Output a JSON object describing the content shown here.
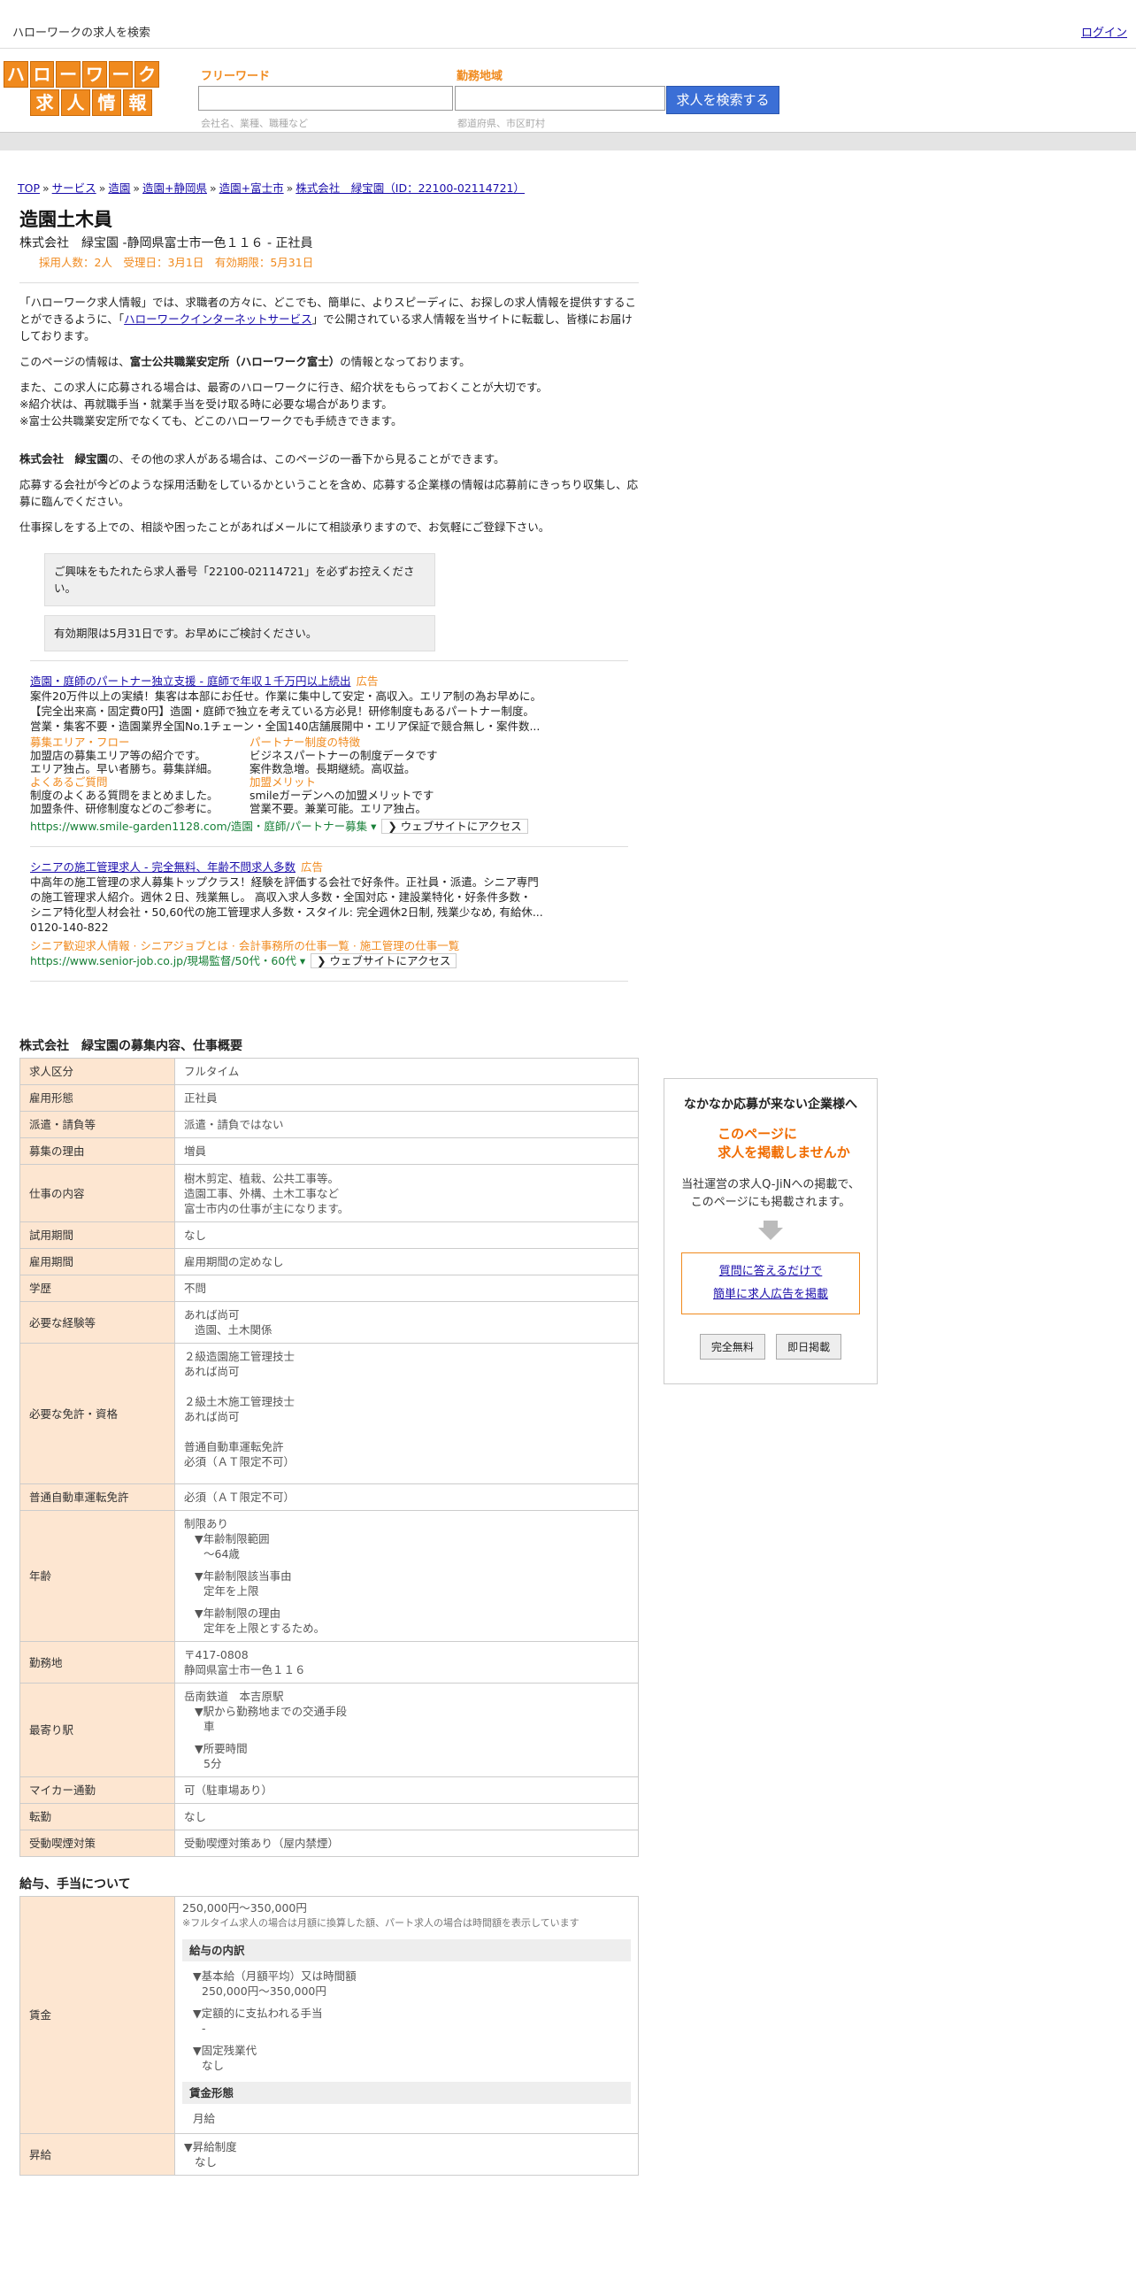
{
  "topbar": {
    "title": "ハローワークの求人を検索",
    "login": "ログイン"
  },
  "logo": {
    "row1": [
      "ハ",
      "ロ",
      "ー",
      "ワ",
      "ー",
      "ク"
    ],
    "row2": [
      "求",
      "人",
      "情",
      "報"
    ]
  },
  "search": {
    "keyword_label": "フリーワード",
    "keyword_placeholder": "会社名、業種、職種など",
    "area_label": "勤務地域",
    "area_placeholder": "都道府県、市区町村",
    "button": "求人を検索する"
  },
  "breadcrumb": [
    "TOP",
    "サービス",
    "造園",
    "造園+静岡県",
    "造園+富士市",
    "株式会社　緑宝園（ID：22100-02114721）"
  ],
  "job": {
    "title": "造園土木員",
    "subtitle": "株式会社　緑宝園 -静岡県富士市一色１１６ - 正社員",
    "meta": "採用人数：2人　受理日：3月1日　有効期限：5月31日"
  },
  "intro": {
    "p1_a": "「ハローワーク求人情報」では、求職者の方々に、どこでも、簡単に、よりスピーディに、お探しの求人情報を提供すすることができるように、「",
    "p1_link": "ハローワークインターネットサービス",
    "p1_b": "」で公開されている求人情報を当サイトに転載し、皆様にお届けしております。",
    "p2_a": "このページの情報は、",
    "p2_b": "富士公共職業安定所（ハローワーク富士）",
    "p2_c": "の情報となっております。",
    "p3_1": "また、この求人に応募される場合は、最寄のハローワークに行き、紹介状をもらっておくことが大切です。",
    "p3_2": "※紹介状は、再就職手当・就業手当を受け取る時に必要な場合があります。",
    "p3_3": "※富士公共職業安定所でなくても、どこのハローワークでも手続きできます。",
    "p4_a": "株式会社　緑宝園",
    "p4_b": "の、その他の求人がある場合は、このページの一番下から見ることができます。",
    "p5": "応募する会社が今どのような採用活動をしているかということを含め、応募する企業様の情報は応募前にきっちり収集し、応募に臨んでください。",
    "p6": "仕事探しをする上での、相談や困ったことがあればメールにて相談承りますので、お気軽にご登録下さい。",
    "notice1": "ご興味をもたれたら求人番号「22100-02114721」を必ずお控えください。",
    "notice2": "有効期限は5月31日です。お早めにご検討ください。"
  },
  "ads": [
    {
      "title": "造園・庭師のパートナー独立支援 - 庭師で年収１千万円以上続出",
      "tag": "広告",
      "l1": "案件20万件以上の実績！集客は本部にお任せ。作業に集中して安定・高収入。エリア制の為お早めに。",
      "l2": "【完全出来高・固定費0円】造園・庭師で独立を考えている方必見！研修制度もあるパートナー制度。",
      "l3": "営業・集客不要・造園業界全国No.1チェーン・全国140店舗展開中・エリア保証で競合無し・案件数...",
      "g1h": "募集エリア・フロー",
      "g1a": "加盟店の募集エリア等の紹介です。",
      "g1b": "エリア独占。早い者勝ち。募集詳細。",
      "g2h": "パートナー制度の特徴",
      "g2a": "ビジネスパートナーの制度データです",
      "g2b": "案件数急増。長期継続。高収益。",
      "g3h": "よくあるご質問",
      "g3a": "制度のよくある質問をまとめました。",
      "g3b": "加盟条件、研修制度などのご参考に。",
      "g4h": "加盟メリット",
      "g4a": "smileガーデンへの加盟メリットです",
      "g4b": "営業不要。兼業可能。エリア独占。",
      "url": "https://www.smile-garden1128.com/造園・庭師/パートナー募集 ▾",
      "visit": "❯ ウェブサイトにアクセス"
    },
    {
      "title": "シニアの施工管理求人 - 完全無料、年齢不問求人多数",
      "tag": "広告",
      "l1": "中高年の施工管理の求人募集トップクラス！経験を評価する会社で好条件。正社員・派遣。シニア専門",
      "l2": "の施工管理求人紹介。週休２日、残業無し。 高収入求人多数・全国対応・建設業特化・好条件多数・",
      "l3": "シニア特化型人材会社・50,60代の施工管理求人多数・スタイル: 完全週休2日制, 残業少なめ, 有給休...",
      "tel": "0120-140-822",
      "links": "シニア歓迎求人情報 · シニアジョブとは · 会計事務所の仕事一覧 · 施工管理の仕事一覧",
      "url": "https://www.senior-job.co.jp/現場監督/50代・60代 ▾",
      "visit": "❯ ウェブサイトにアクセス"
    }
  ],
  "overview": {
    "heading": "株式会社　緑宝園の募集内容、仕事概要",
    "rows": {
      "r1": [
        "求人区分",
        "フルタイム"
      ],
      "r2": [
        "雇用形態",
        "正社員"
      ],
      "r3": [
        "派遣・請負等",
        "派遣・請負ではない"
      ],
      "r4": [
        "募集の理由",
        "増員"
      ],
      "r5": [
        "仕事の内容",
        "樹木剪定、植栽、公共工事等。",
        "造園工事、外構、土木工事など",
        "富士市内の仕事が主になります。"
      ],
      "r6": [
        "試用期間",
        "なし"
      ],
      "r7": [
        "雇用期間",
        "雇用期間の定めなし"
      ],
      "r8": [
        "学歴",
        "不問"
      ],
      "r9": [
        "必要な経験等",
        "あれば尚可",
        "造園、土木関係"
      ],
      "r10": [
        "必要な免許・資格",
        "２級造園施工管理技士",
        "あれば尚可",
        "２級土木施工管理技士",
        "あれば尚可",
        "普通自動車運転免許",
        "必須（ＡＴ限定不可）"
      ],
      "r11": [
        "普通自動車運転免許",
        "必須（ＡＴ限定不可）"
      ],
      "r12": [
        "年齢",
        "制限あり",
        "▼年齢制限範囲",
        "〜64歳",
        "▼年齢制限該当事由",
        "定年を上限",
        "▼年齢制限の理由",
        "定年を上限とするため。"
      ],
      "r13": [
        "勤務地",
        "〒417-0808",
        "静岡県富士市一色１１６"
      ],
      "r14": [
        "最寄り駅",
        "岳南鉄道　本吉原駅",
        "▼駅から勤務地までの交通手段",
        "車",
        "▼所要時間",
        "5分"
      ],
      "r15": [
        "マイカー通勤",
        "可（駐車場あり）"
      ],
      "r16": [
        "転勤",
        "なし"
      ],
      "r17": [
        "受動喫煙対策",
        "受動喫煙対策あり（屋内禁煙）"
      ]
    }
  },
  "salary": {
    "heading": "給与、手当について",
    "wage_key": "賃金",
    "wage_range": "250,000円〜350,000円",
    "wage_note": "※フルタイム求人の場合は月額に換算した額、パート求人の場合は時間額を表示しています",
    "breakdown_h": "給与の内訳",
    "base_h": "▼基本給（月額平均）又は時間額",
    "base_v": "250,000円〜350,000円",
    "fixed_h": "▼定額的に支払われる手当",
    "fixed_v": "-",
    "ot_h": "▼固定残業代",
    "ot_v": "なし",
    "form_h": "賃金形態",
    "form_v": "月給",
    "raise_key": "昇給",
    "raise_h": "▼昇給制度",
    "raise_v": "なし"
  },
  "side": {
    "heading": "なかなか応募が来ない企業様へ",
    "promo1": "このページに",
    "promo2": "求人を掲載しませんか",
    "desc1": "当社運営の求人Q-JiNへの掲載で、",
    "desc2": "このページにも掲載されます。",
    "link1": "質問に答えるだけで",
    "link2": "簡単に求人広告を掲載",
    "btn1": "完全無料",
    "btn2": "即日掲載"
  }
}
